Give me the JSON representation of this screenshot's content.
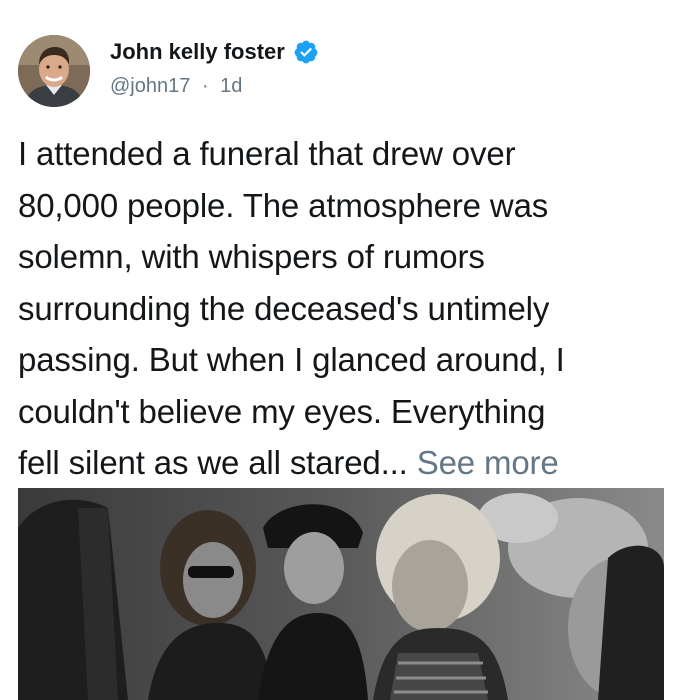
{
  "author": {
    "display_name": "John kelly foster",
    "handle": "@john17",
    "separator": "·",
    "time_ago": "1d",
    "verified": true,
    "avatar_icon": "user-avatar-photo"
  },
  "tweet": {
    "lines": [
      "I attended a funeral that drew over",
      "80,000 people. The atmosphere was",
      "solemn, with whispers of rumors",
      "surrounding the deceased's untimely",
      "passing. But when I glanced around, I",
      "couldn't believe my eyes. Everything",
      "fell silent as we all stared..."
    ],
    "see_more": "See more"
  },
  "media": {
    "kind": "black-and-white-photo",
    "icon": "photo-image"
  },
  "colors": {
    "text": "#14171a",
    "secondary": "#657786",
    "verified_blue": "#1da1f2",
    "background": "#ffffff"
  }
}
